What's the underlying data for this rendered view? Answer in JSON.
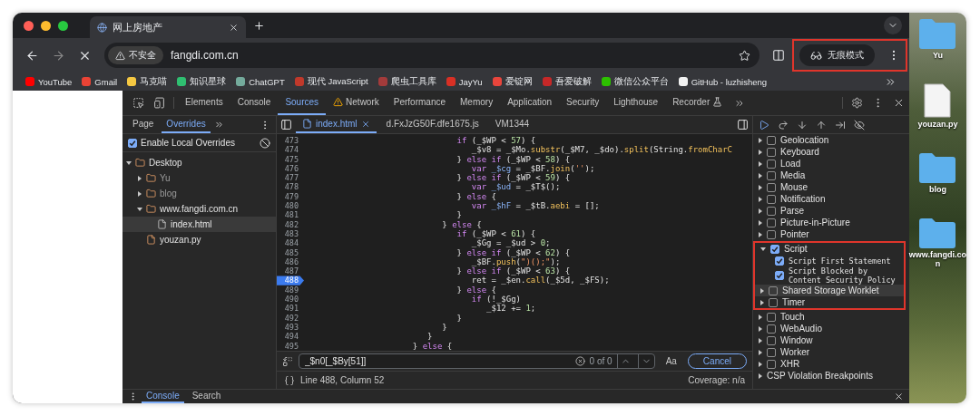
{
  "browser": {
    "tabs": [
      {
        "title": "网上房地产",
        "selected": true
      }
    ],
    "address": {
      "security": "不安全",
      "url": "fangdi.com.cn"
    },
    "profile_chip": "无痕模式",
    "bookmarks": [
      {
        "label": "YouTube",
        "color": "#ff0000"
      },
      {
        "label": "Gmail",
        "color": "#ea4335"
      },
      {
        "label": "马克喵",
        "color": "#f5c842"
      },
      {
        "label": "知识星球",
        "color": "#2fbf71"
      },
      {
        "label": "ChatGPT",
        "color": "#74aa9c"
      },
      {
        "label": "现代 JavaScript",
        "color": "#c0392b"
      },
      {
        "label": "爬虫工具库",
        "color": "#a33b3b"
      },
      {
        "label": "JayYu",
        "color": "#d93025"
      },
      {
        "label": "爱锭网",
        "color": "#e8453c"
      },
      {
        "label": "吾爱破解",
        "color": "#c62828"
      },
      {
        "label": "微信公众平台",
        "color": "#2dc100"
      },
      {
        "label": "GitHub - luzhisheng",
        "color": "#f1f1f1"
      }
    ]
  },
  "devtools": {
    "panel_tabs": [
      {
        "label": "Elements",
        "selected": false,
        "kind": "plain"
      },
      {
        "label": "Console",
        "selected": false,
        "kind": "plain"
      },
      {
        "label": "Sources",
        "selected": true,
        "kind": "plain"
      },
      {
        "label": "Network",
        "selected": false,
        "kind": "warning"
      },
      {
        "label": "Performance",
        "selected": false,
        "kind": "plain"
      },
      {
        "label": "Memory",
        "selected": false,
        "kind": "plain"
      },
      {
        "label": "Application",
        "selected": false,
        "kind": "plain"
      },
      {
        "label": "Security",
        "selected": false,
        "kind": "plain"
      },
      {
        "label": "Lighthouse",
        "selected": false,
        "kind": "plain"
      },
      {
        "label": "Recorder",
        "selected": false,
        "kind": "experiment"
      }
    ],
    "sidebar": {
      "tabs": [
        {
          "label": "Page",
          "selected": false
        },
        {
          "label": "Overrides",
          "selected": true
        }
      ],
      "enable_overrides": {
        "label": "Enable Local Overrides",
        "checked": true
      },
      "tree": [
        {
          "name": "Desktop",
          "kind": "folder",
          "expanded": true,
          "selected": false,
          "dimmed": false,
          "children": [
            {
              "name": "Yu",
              "kind": "folder",
              "expanded": false,
              "selected": false,
              "dimmed": true
            },
            {
              "name": "blog",
              "kind": "folder",
              "expanded": false,
              "selected": false,
              "dimmed": true
            },
            {
              "name": "www.fangdi.com.cn",
              "kind": "folder",
              "expanded": true,
              "selected": false,
              "dimmed": false,
              "children": [
                {
                  "name": "index.html",
                  "kind": "override",
                  "selected": true,
                  "dimmed": false
                }
              ]
            },
            {
              "name": "youzan.py",
              "kind": "file",
              "selected": false,
              "dimmed": false
            }
          ]
        }
      ]
    },
    "editor": {
      "tabs": [
        {
          "label": "index.html",
          "selected": true,
          "kind": "override"
        },
        {
          "label": "d.FxJzG50F.dfe1675.js",
          "selected": false,
          "kind": "script"
        },
        {
          "label": "VM1344",
          "selected": false,
          "kind": "script"
        }
      ],
      "lines": [
        {
          "number": "473",
          "breakpoint": false,
          "tokens": [
            {
              "text": "                              if",
              "kind": "keyword"
            },
            {
              "text": " (_$WP < ",
              "kind": "plain"
            },
            {
              "text": "57",
              "kind": "number"
            },
            {
              "text": ") {",
              "kind": "plain"
            }
          ]
        },
        {
          "number": "474",
          "breakpoint": false,
          "tokens": [
            {
              "text": "                                 _$v8 = _$Mo.",
              "kind": "plain"
            },
            {
              "text": "substr",
              "kind": "method"
            },
            {
              "text": "(_$M7, _$do).",
              "kind": "plain"
            },
            {
              "text": "split",
              "kind": "method"
            },
            {
              "text": "(String.",
              "kind": "plain"
            },
            {
              "text": "fromCharC",
              "kind": "method"
            }
          ]
        },
        {
          "number": "475",
          "breakpoint": false,
          "tokens": [
            {
              "text": "                              } ",
              "kind": "plain"
            },
            {
              "text": "else if",
              "kind": "keyword"
            },
            {
              "text": " (_$WP < ",
              "kind": "plain"
            },
            {
              "text": "58",
              "kind": "number"
            },
            {
              "text": ") {",
              "kind": "plain"
            }
          ]
        },
        {
          "number": "476",
          "breakpoint": false,
          "tokens": [
            {
              "text": "                                 var",
              "kind": "keyword"
            },
            {
              "text": " _$cg",
              "kind": "def"
            },
            {
              "text": " = _$BF.",
              "kind": "plain"
            },
            {
              "text": "join",
              "kind": "method"
            },
            {
              "text": "(",
              "kind": "plain"
            },
            {
              "text": "''",
              "kind": "string"
            },
            {
              "text": ");",
              "kind": "plain"
            }
          ]
        },
        {
          "number": "477",
          "breakpoint": false,
          "tokens": [
            {
              "text": "                              } ",
              "kind": "plain"
            },
            {
              "text": "else if",
              "kind": "keyword"
            },
            {
              "text": " (_$WP < ",
              "kind": "plain"
            },
            {
              "text": "59",
              "kind": "number"
            },
            {
              "text": ") {",
              "kind": "plain"
            }
          ]
        },
        {
          "number": "478",
          "breakpoint": false,
          "tokens": [
            {
              "text": "                                 var",
              "kind": "keyword"
            },
            {
              "text": " _$ud",
              "kind": "def"
            },
            {
              "text": " = _$T$();",
              "kind": "plain"
            }
          ]
        },
        {
          "number": "479",
          "breakpoint": false,
          "tokens": [
            {
              "text": "                              } ",
              "kind": "plain"
            },
            {
              "text": "else",
              "kind": "keyword"
            },
            {
              "text": " {",
              "kind": "plain"
            }
          ]
        },
        {
          "number": "480",
          "breakpoint": false,
          "tokens": [
            {
              "text": "                                 var",
              "kind": "keyword"
            },
            {
              "text": " _$hF",
              "kind": "def"
            },
            {
              "text": " = _$tB.",
              "kind": "plain"
            },
            {
              "text": "aebi",
              "kind": "method"
            },
            {
              "text": " = [];",
              "kind": "plain"
            }
          ]
        },
        {
          "number": "481",
          "breakpoint": false,
          "tokens": [
            {
              "text": "                              }",
              "kind": "plain"
            }
          ]
        },
        {
          "number": "482",
          "breakpoint": false,
          "tokens": [
            {
              "text": "                           } ",
              "kind": "plain"
            },
            {
              "text": "else",
              "kind": "keyword"
            },
            {
              "text": " {",
              "kind": "plain"
            }
          ]
        },
        {
          "number": "483",
          "breakpoint": false,
          "tokens": [
            {
              "text": "                              if",
              "kind": "keyword"
            },
            {
              "text": " (_$WP < ",
              "kind": "plain"
            },
            {
              "text": "61",
              "kind": "number"
            },
            {
              "text": ") {",
              "kind": "plain"
            }
          ]
        },
        {
          "number": "484",
          "breakpoint": false,
          "tokens": [
            {
              "text": "                                 _$Gg = _$ud > ",
              "kind": "plain"
            },
            {
              "text": "0",
              "kind": "number"
            },
            {
              "text": ";",
              "kind": "plain"
            }
          ]
        },
        {
          "number": "485",
          "breakpoint": false,
          "tokens": [
            {
              "text": "                              } ",
              "kind": "plain"
            },
            {
              "text": "else if",
              "kind": "keyword"
            },
            {
              "text": " (_$WP < ",
              "kind": "plain"
            },
            {
              "text": "62",
              "kind": "number"
            },
            {
              "text": ") {",
              "kind": "plain"
            }
          ]
        },
        {
          "number": "486",
          "breakpoint": false,
          "tokens": [
            {
              "text": "                                 _$BF.",
              "kind": "plain"
            },
            {
              "text": "push",
              "kind": "method"
            },
            {
              "text": "(",
              "kind": "plain"
            },
            {
              "text": "\")();\"",
              "kind": "string"
            },
            {
              "text": ");",
              "kind": "plain"
            }
          ]
        },
        {
          "number": "487",
          "breakpoint": false,
          "tokens": [
            {
              "text": "                              } ",
              "kind": "plain"
            },
            {
              "text": "else if",
              "kind": "keyword"
            },
            {
              "text": " (_$WP < ",
              "kind": "plain"
            },
            {
              "text": "63",
              "kind": "number"
            },
            {
              "text": ") {",
              "kind": "plain"
            }
          ]
        },
        {
          "number": "488",
          "breakpoint": true,
          "tokens": [
            {
              "text": "                                 ret = _$en.",
              "kind": "plain"
            },
            {
              "text": "call",
              "kind": "method"
            },
            {
              "text": "(_$5d, _$FS);",
              "kind": "plain"
            }
          ]
        },
        {
          "number": "489",
          "breakpoint": false,
          "tokens": [
            {
              "text": "                              } ",
              "kind": "plain"
            },
            {
              "text": "else",
              "kind": "keyword"
            },
            {
              "text": " {",
              "kind": "plain"
            }
          ]
        },
        {
          "number": "490",
          "breakpoint": false,
          "tokens": [
            {
              "text": "                                 if",
              "kind": "keyword"
            },
            {
              "text": " (!_$Gg)",
              "kind": "plain"
            }
          ]
        },
        {
          "number": "491",
          "breakpoint": false,
          "tokens": [
            {
              "text": "                                    _$12 += ",
              "kind": "plain"
            },
            {
              "text": "1",
              "kind": "number"
            },
            {
              "text": ";",
              "kind": "plain"
            }
          ]
        },
        {
          "number": "492",
          "breakpoint": false,
          "tokens": [
            {
              "text": "                              }",
              "kind": "plain"
            }
          ]
        },
        {
          "number": "493",
          "breakpoint": false,
          "tokens": [
            {
              "text": "                           }",
              "kind": "plain"
            }
          ]
        },
        {
          "number": "494",
          "breakpoint": false,
          "tokens": [
            {
              "text": "                        }",
              "kind": "plain"
            }
          ]
        },
        {
          "number": "495",
          "breakpoint": false,
          "tokens": [
            {
              "text": "                     } ",
              "kind": "plain"
            },
            {
              "text": "else",
              "kind": "keyword"
            },
            {
              "text": " {",
              "kind": "plain"
            }
          ]
        }
      ],
      "search": {
        "value": "_$n0[_$By[51]]",
        "matches": "0 of 0",
        "case_button": "Aa",
        "cancel": "Cancel"
      },
      "status": {
        "position": "Line 488, Column 52",
        "coverage": "Coverage: n/a"
      }
    },
    "breakpoints": {
      "items": [
        {
          "label": "Geolocation",
          "expanded": false,
          "checked": false,
          "selected": false
        },
        {
          "label": "Keyboard",
          "expanded": false,
          "checked": false,
          "selected": false
        },
        {
          "label": "Load",
          "expanded": false,
          "checked": false,
          "selected": false
        },
        {
          "label": "Media",
          "expanded": false,
          "checked": false,
          "selected": false
        },
        {
          "label": "Mouse",
          "expanded": false,
          "checked": false,
          "selected": false
        },
        {
          "label": "Notification",
          "expanded": false,
          "checked": false,
          "selected": false
        },
        {
          "label": "Parse",
          "expanded": false,
          "checked": false,
          "selected": false
        },
        {
          "label": "Picture-in-Picture",
          "expanded": false,
          "checked": false,
          "selected": false
        },
        {
          "label": "Pointer",
          "expanded": false,
          "checked": false,
          "selected": false
        },
        {
          "label": "Script",
          "expanded": true,
          "checked": true,
          "selected": false,
          "children": [
            {
              "label": "Script First Statement",
              "checked": true
            },
            {
              "label": "Script Blocked by Content Security Policy",
              "checked": true
            }
          ]
        },
        {
          "label": "Shared Storage Worklet",
          "expanded": false,
          "checked": false,
          "selected": true
        },
        {
          "label": "Timer",
          "expanded": false,
          "checked": false,
          "selected": false
        },
        {
          "label": "Touch",
          "expanded": false,
          "checked": false,
          "selected": false
        },
        {
          "label": "WebAudio",
          "expanded": false,
          "checked": false,
          "selected": false
        },
        {
          "label": "Window",
          "expanded": false,
          "checked": false,
          "selected": false
        },
        {
          "label": "Worker",
          "expanded": false,
          "checked": false,
          "selected": false
        },
        {
          "label": "XHR",
          "expanded": false,
          "checked": false,
          "selected": false
        }
      ],
      "section": {
        "label": "CSP Violation Breakpoints",
        "expanded": false
      }
    },
    "drawer": {
      "tabs": [
        {
          "label": "Console",
          "selected": true
        },
        {
          "label": "Search",
          "selected": false
        }
      ]
    }
  },
  "desktop": {
    "icons": [
      {
        "label": "Yu",
        "kind": "folder"
      },
      {
        "label": "youzan.py",
        "kind": "file"
      },
      {
        "label": "blog",
        "kind": "folder"
      },
      {
        "label": "www.fangdi.co\nn",
        "kind": "folder"
      }
    ]
  }
}
